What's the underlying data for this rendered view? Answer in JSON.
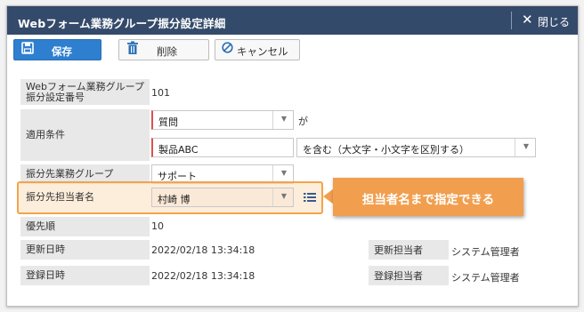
{
  "window": {
    "title": "Webフォーム業務グループ振分設定詳細",
    "close_label": "閉じる"
  },
  "toolbar": {
    "save_label": "保存",
    "delete_label": "削除",
    "cancel_label": "キャンセル"
  },
  "form": {
    "group_no_label": "Webフォーム業務グループ振分設定番号",
    "group_no_value": "101",
    "condition_label": "適用条件",
    "condition_field": "質問",
    "condition_connector": "が",
    "condition_value": "製品ABC",
    "condition_operator": "を含む（大文字・小文字を区別する）",
    "target_group_label": "振分先業務グループ",
    "target_group_value": "サポート",
    "target_person_label": "振分先担当者名",
    "target_person_value": "村崎 博",
    "priority_label": "優先順",
    "priority_value": "10",
    "updated_label": "更新日時",
    "updated_value": "2022/02/18 13:34:18",
    "updated_by_label": "更新担当者",
    "updated_by_value": "システム管理者",
    "created_label": "登録日時",
    "created_value": "2022/02/18 13:34:18",
    "created_by_label": "登録担当者",
    "created_by_value": "システム管理者"
  },
  "callout": {
    "text": "担当者名まで指定できる"
  },
  "icons": {
    "close": "close-icon",
    "save": "save-icon",
    "delete": "trash-icon",
    "cancel": "cancel-icon",
    "dropdown": "chevron-down-icon",
    "list": "list-icon"
  },
  "colors": {
    "titlebar": "#344a6b",
    "primary": "#2f7fd0",
    "callout": "#f19f4f",
    "required": "#d9534f"
  }
}
